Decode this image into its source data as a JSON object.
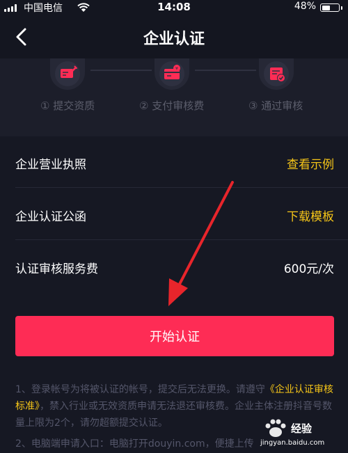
{
  "status_bar": {
    "carrier": "中国电信",
    "time": "14:08",
    "battery_percent": "48%",
    "battery_level": 0.48
  },
  "nav": {
    "title": "企业认证",
    "back_icon": "chevron-left-icon"
  },
  "steps": [
    {
      "label": "① 提交资质",
      "icon": "document-edit-icon"
    },
    {
      "label": "② 支付审核费",
      "icon": "payment-card-icon"
    },
    {
      "label": "③ 通过审核",
      "icon": "approved-badge-icon"
    }
  ],
  "rows": [
    {
      "label": "企业营业执照",
      "value": "查看示例",
      "value_is_link": true
    },
    {
      "label": "企业认证公函",
      "value": "下载模板",
      "value_is_link": true
    },
    {
      "label": "认证审核服务费",
      "value": "600元/次",
      "value_is_link": false
    }
  ],
  "primary_button": {
    "label": "开始认证"
  },
  "notes": {
    "p1_a": "1、登录帐号为将被认证的帐号，提交后无法更换。请遵守",
    "p1_link": "《企业认证审核标准》",
    "p1_b": "，禁入行业或无效资质申请无法退还审核费。企业主体注册抖音号数量上限为2个，请勿超额提交认证。",
    "p2": "2、电脑端申请入口：电脑打开douyin.com，便捷上传"
  },
  "colors": {
    "background": "#161823",
    "accent": "#fe2c55",
    "link": "#f5c518",
    "annotation_arrow": "#e8252b"
  },
  "watermark": {
    "brand": "Bai 经验",
    "url": "jingyan.baidu.com"
  }
}
